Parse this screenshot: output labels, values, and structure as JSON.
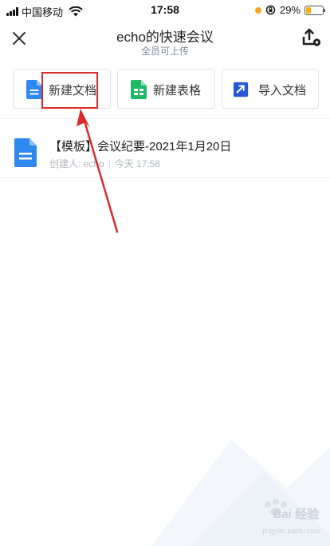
{
  "status_bar": {
    "carrier": "中国移动",
    "time": "17:58",
    "battery": "29%",
    "battery_level": 0.29
  },
  "header": {
    "title": "echo的快速会议",
    "subtitle": "全员可上传"
  },
  "actions": {
    "new_doc": "新建文档",
    "new_sheet": "新建表格",
    "import_doc": "导入文档"
  },
  "files": [
    {
      "name": "【模板】会议纪要-2021年1月20日",
      "creator": "创建人: echo",
      "time": "今天 17:58"
    }
  ],
  "watermark": {
    "brand": "Bai 经验",
    "url": "jingyan.baidu.com"
  },
  "colors": {
    "doc_blue": "#2f87f0",
    "sheet_green": "#1fb866",
    "import_blue": "#2855d8",
    "annotation_red": "#d92b2b"
  },
  "icons": {
    "close": "close-icon",
    "share": "share-upload-icon",
    "doc": "document-icon",
    "sheet": "spreadsheet-icon",
    "import": "import-arrow-icon"
  }
}
